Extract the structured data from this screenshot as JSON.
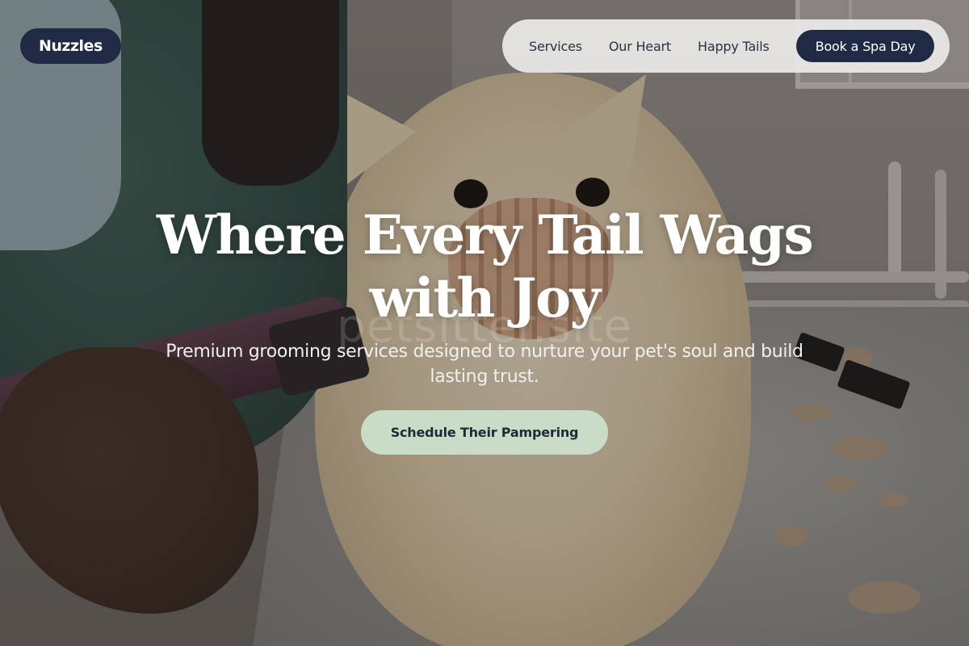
{
  "brand": {
    "name": "Nuzzles"
  },
  "nav": {
    "links": [
      "Services",
      "Our Heart",
      "Happy Tails"
    ],
    "cta_label": "Book a Spa Day"
  },
  "hero": {
    "headline_line1": "Where Every Tail Wags",
    "headline_line2": "with Joy",
    "subheadline": "Premium grooming services designed to nurture your pet's soul and build lasting trust.",
    "cta_label": "Schedule Their Pampering",
    "watermark": "petsitter.site",
    "image": "Groomer holding clippers next to a fluffy cream Pomeranian wearing a basket muzzle on a grooming table"
  },
  "colors": {
    "navy": "#1f2a44",
    "sage": "#c9dcc5",
    "nav_bg": "#eceae8",
    "text_light": "#ffffff"
  }
}
